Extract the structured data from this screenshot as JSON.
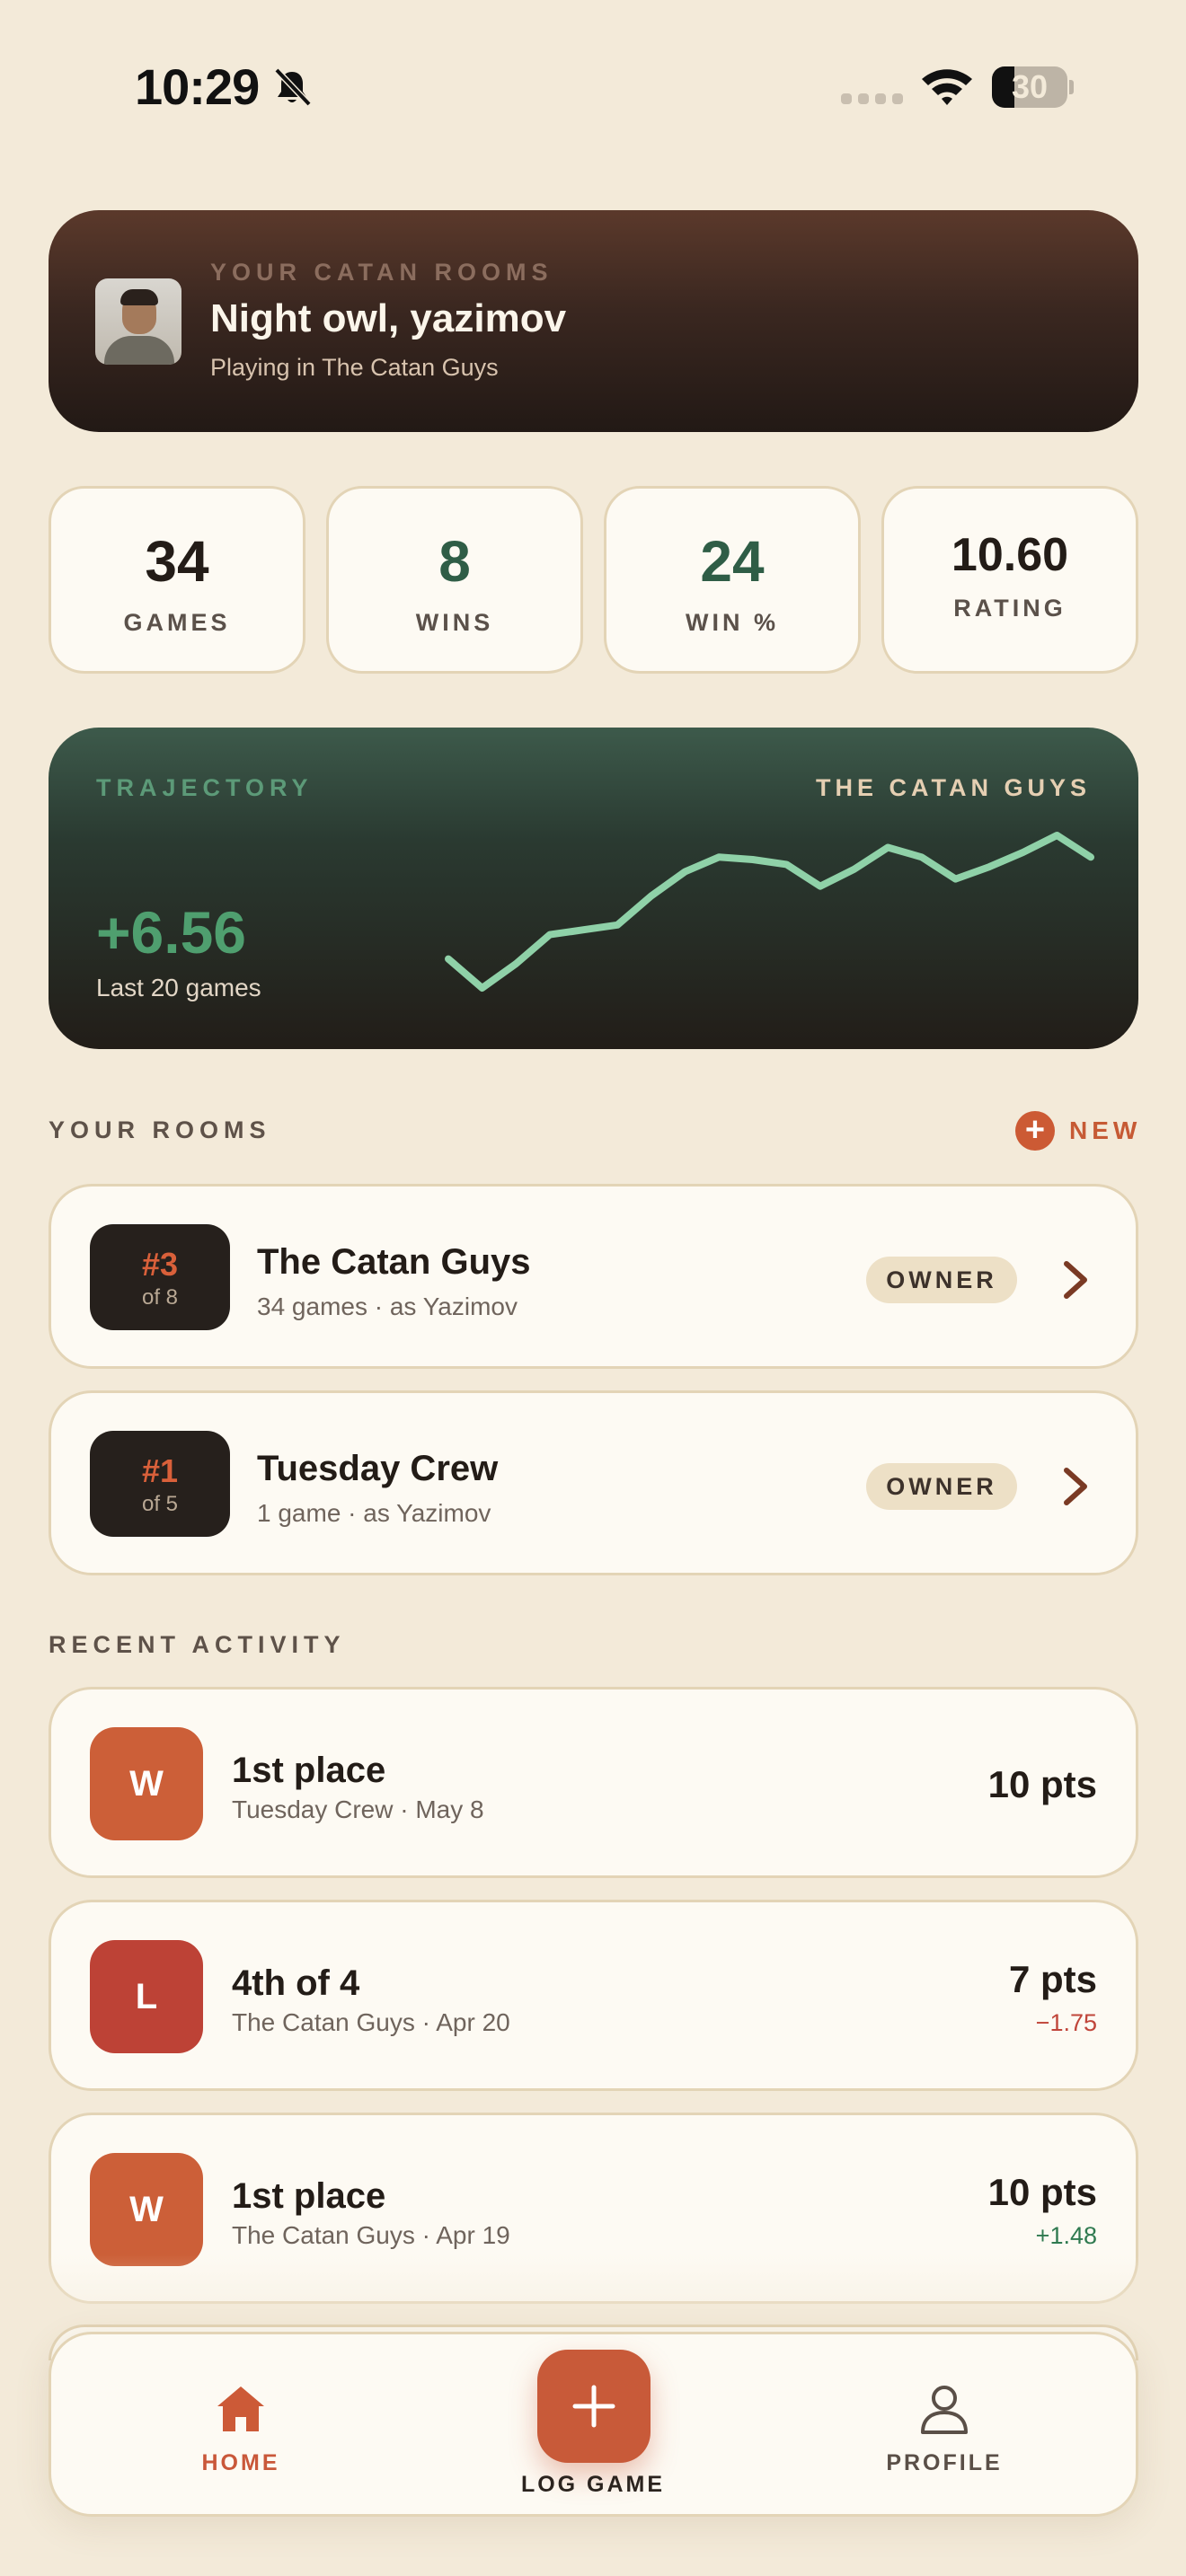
{
  "status_bar": {
    "time": "10:29",
    "battery": "30",
    "battery_level_pct": 30
  },
  "header": {
    "kicker": "YOUR CATAN ROOMS",
    "greeting": "Night owl, yazimov",
    "subtitle": "Playing in The Catan Guys"
  },
  "stats": [
    {
      "value": "34",
      "label": "GAMES",
      "color": "#231c17"
    },
    {
      "value": "8",
      "label": "WINS",
      "color": "#2f5d46"
    },
    {
      "value": "24",
      "label": "WIN %",
      "color": "#2f5d46"
    },
    {
      "value": "10.60",
      "label": "RATING",
      "color": "#231c17"
    }
  ],
  "trajectory": {
    "kicker": "TRAJECTORY",
    "room": "THE CATAN GUYS",
    "delta": "+6.56",
    "subtitle": "Last 20 games",
    "line_color": "#8fd1a8",
    "values": [
      0.4,
      -0.8,
      0.2,
      1.4,
      1.6,
      1.8,
      3.0,
      4.0,
      4.6,
      4.5,
      4.3,
      3.4,
      4.1,
      5.0,
      4.6,
      3.7,
      4.2,
      4.8,
      5.5,
      4.6
    ]
  },
  "rooms_section": {
    "title": "YOUR ROOMS",
    "new_label": "NEW"
  },
  "rooms": [
    {
      "rank": "#3",
      "of": "of 8",
      "name": "The Catan Guys",
      "sub": "34 games · as Yazimov",
      "role": "OWNER"
    },
    {
      "rank": "#1",
      "of": "of 5",
      "name": "Tuesday Crew",
      "sub": "1 game · as Yazimov",
      "role": "OWNER"
    }
  ],
  "activity_section": {
    "title": "RECENT ACTIVITY"
  },
  "activity": [
    {
      "badge": "W",
      "badge_color": "#cc5f38",
      "title": "1st place",
      "sub": "Tuesday Crew · May 8",
      "points": "10 pts",
      "delta": "",
      "delta_color": "#2f7a50"
    },
    {
      "badge": "L",
      "badge_color": "#bd4236",
      "title": "4th of 4",
      "sub": "The Catan Guys · Apr 20",
      "points": "7 pts",
      "delta": "−1.75",
      "delta_color": "#c0453a"
    },
    {
      "badge": "W",
      "badge_color": "#cc5f38",
      "title": "1st place",
      "sub": "The Catan Guys · Apr 19",
      "points": "10 pts",
      "delta": "+1.48",
      "delta_color": "#2f7a50"
    }
  ],
  "nav": {
    "home": "HOME",
    "log_game": "LOG GAME",
    "profile": "PROFILE"
  }
}
